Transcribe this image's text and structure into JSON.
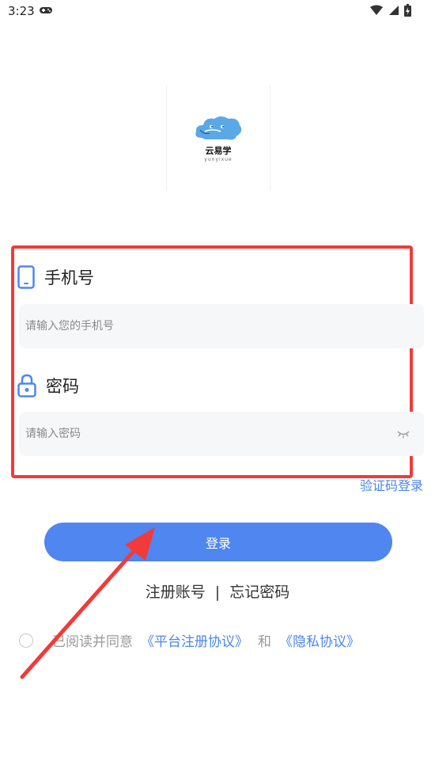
{
  "status_bar": {
    "time": "3:23"
  },
  "logo": {
    "name": "云易学",
    "subtitle": "yunyixue"
  },
  "form": {
    "phone_label": "手机号",
    "phone_placeholder": "请输入您的手机号",
    "password_label": "密码",
    "password_placeholder": "请输入密码"
  },
  "sms_login": "验证码登录",
  "login_button": "登录",
  "links": {
    "register": "注册账号",
    "separator": "|",
    "forgot": "忘记密码"
  },
  "agreement": {
    "prefix": "已阅读并同意",
    "platform_link": "《平台注册协议》",
    "and": "和",
    "privacy_link": "《隐私协议》"
  },
  "colors": {
    "accent": "#4f86ef",
    "highlight": "#f23a3a",
    "arrow": "#f23a3a"
  },
  "icons": [
    "gamepad-icon",
    "wifi-icon",
    "signal-icon",
    "battery-icon",
    "phone-icon",
    "lock-icon",
    "eye-closed-icon",
    "arrow-annotation"
  ]
}
